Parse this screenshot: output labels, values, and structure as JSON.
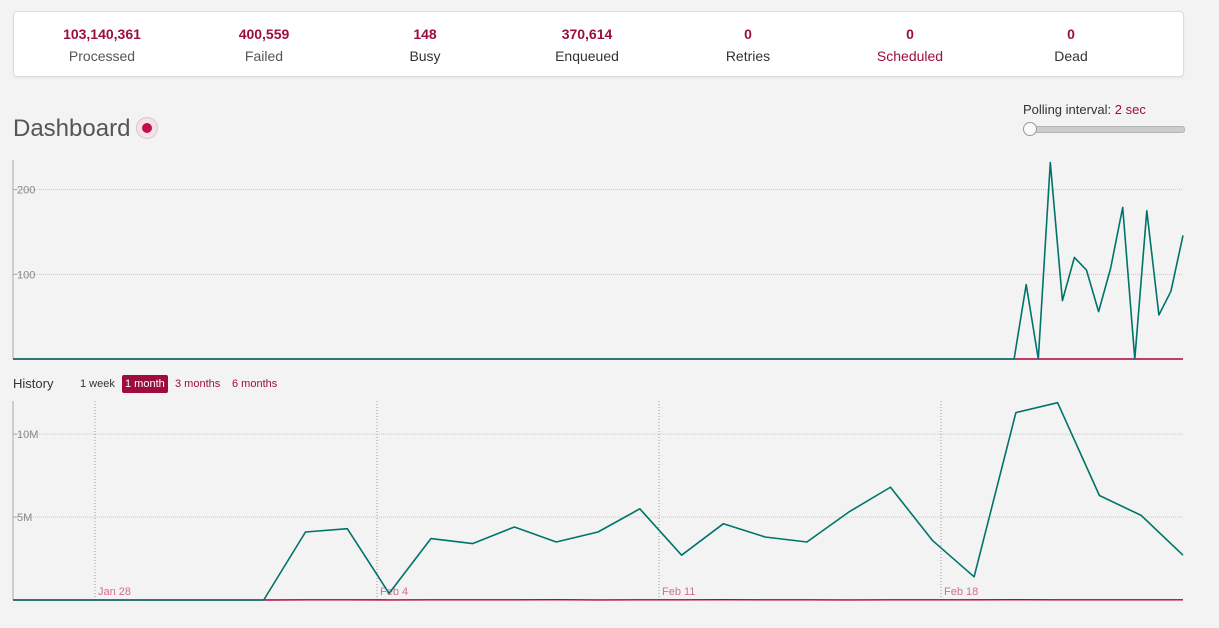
{
  "stats": [
    {
      "value": "103,140,361",
      "label": "Processed",
      "kind": "muted"
    },
    {
      "value": "400,559",
      "label": "Failed",
      "kind": "muted"
    },
    {
      "value": "148",
      "label": "Busy",
      "kind": "plain"
    },
    {
      "value": "370,614",
      "label": "Enqueued",
      "kind": "plain"
    },
    {
      "value": "0",
      "label": "Retries",
      "kind": "plain"
    },
    {
      "value": "0",
      "label": "Scheduled",
      "kind": "link"
    },
    {
      "value": "0",
      "label": "Dead",
      "kind": "plain"
    }
  ],
  "dashboard": {
    "title": "Dashboard"
  },
  "polling": {
    "label": "Polling interval:",
    "value": "2 sec",
    "level": 0
  },
  "history": {
    "label": "History",
    "ranges": [
      "1 week",
      "1 month",
      "3 months",
      "6 months"
    ],
    "active_range": "1 month"
  },
  "colors": {
    "accent": "#9e0e3c",
    "processed": "#00736b",
    "failed": "#b1003e"
  },
  "chart_data": [
    {
      "type": "line",
      "title": "",
      "ylim": [
        0,
        235
      ],
      "yticks": [
        "100",
        "200"
      ],
      "series": [
        {
          "color": "#00736b",
          "values": [
            0,
            0,
            0,
            0,
            0,
            0,
            0,
            0,
            0,
            0,
            0,
            0,
            0,
            0,
            0,
            0,
            0,
            0,
            0,
            0,
            0,
            0,
            0,
            0,
            0,
            0,
            0,
            0,
            0,
            0,
            0,
            0,
            0,
            0,
            0,
            0,
            0,
            0,
            0,
            0,
            0,
            0,
            0,
            0,
            0,
            0,
            0,
            0,
            0,
            0,
            0,
            0,
            0,
            0,
            0,
            0,
            0,
            0,
            0,
            0,
            0,
            0,
            0,
            0,
            0,
            0,
            0,
            0,
            0,
            0,
            0,
            0,
            0,
            0,
            0,
            0,
            0,
            0,
            0,
            0,
            0,
            0,
            0,
            0,
            88,
            0,
            232,
            69,
            120,
            105,
            56,
            107,
            179,
            0,
            175,
            52,
            80,
            146
          ]
        },
        {
          "color": "#b1003e",
          "values": [
            0,
            0,
            0,
            0,
            0,
            0,
            0,
            0,
            0,
            0,
            0,
            0,
            0,
            0,
            0,
            0,
            0,
            0,
            0,
            0,
            0,
            0,
            0,
            0,
            0,
            0,
            0,
            0,
            0,
            0,
            0,
            0,
            0,
            0,
            0,
            0,
            0,
            0,
            0,
            0,
            0,
            0,
            0,
            0,
            0,
            0,
            0,
            0,
            0,
            0,
            0,
            0,
            0,
            0,
            0,
            0,
            0,
            0,
            0,
            0,
            0,
            0,
            0,
            0,
            0,
            0,
            0,
            0,
            0,
            0,
            0,
            0,
            0,
            0,
            0,
            0,
            0,
            0,
            0,
            0,
            0,
            0,
            0,
            0,
            0,
            0,
            0,
            0,
            0,
            0,
            0,
            0,
            0,
            0,
            0,
            0,
            0,
            0
          ]
        }
      ]
    },
    {
      "type": "line",
      "title": "",
      "ylim": [
        0,
        12000000
      ],
      "yticks": [
        "5M",
        "10M"
      ],
      "xtick_labels": [
        "Jan 28",
        "Feb 4",
        "Feb 11",
        "Feb 18"
      ],
      "series": [
        {
          "color": "#00736b",
          "values": [
            0,
            0,
            0,
            0,
            0,
            0,
            0,
            4100000,
            4300000,
            400000,
            3700000,
            3400000,
            4400000,
            3500000,
            4100000,
            5500000,
            2700000,
            4600000,
            3800000,
            3500000,
            5300000,
            6800000,
            3600000,
            1400000,
            11300000,
            11900000,
            6300000,
            5100000,
            2700000
          ]
        },
        {
          "color": "#b1003e",
          "values": [
            0,
            0,
            0,
            0,
            0,
            0,
            0,
            10000,
            14000,
            9000,
            12000,
            15000,
            11000,
            16000,
            9000,
            12000,
            14000,
            16000,
            13000,
            10000,
            9000,
            12000,
            14000,
            10000,
            16000,
            14000,
            11000,
            12000,
            10000
          ]
        }
      ]
    }
  ]
}
